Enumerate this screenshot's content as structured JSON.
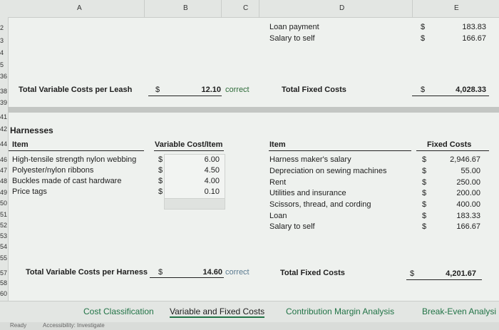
{
  "column_headers": [
    "A",
    "B",
    "C",
    "D",
    "E"
  ],
  "row_numbers": {
    "r2": "2",
    "r3": "3",
    "r4": "4",
    "r5": "5",
    "r6": "36",
    "r38": "38",
    "r39": "39",
    "r41": "41",
    "r42": "42",
    "r44": "44",
    "r46": "46",
    "r47": "47",
    "r48": "48",
    "r49": "49",
    "r50": "50",
    "r51": "51",
    "r52": "52",
    "r53": "53",
    "r54": "54",
    "r55": "55",
    "r57": "57",
    "r58": "58",
    "r60": "60"
  },
  "leash": {
    "fixed_items": [
      {
        "label": "Loan payment",
        "currency": "$",
        "value": "183.83"
      },
      {
        "label": "Salary to self",
        "currency": "$",
        "value": "166.67"
      }
    ],
    "total_variable_label": "Total Variable Costs per Leash",
    "total_variable_currency": "$",
    "total_variable_value": "12.10",
    "total_variable_check": "correct",
    "total_fixed_label": "Total Fixed Costs",
    "total_fixed_currency": "$",
    "total_fixed_value": "4,028.33"
  },
  "harnesses": {
    "title": "Harnesses",
    "item_header": "Item",
    "varcost_header": "Variable Cost/Item",
    "fixed_item_header": "Item",
    "fixed_cost_header": "Fixed Costs",
    "variable_items": [
      {
        "label": "High-tensile strength nylon webbing",
        "currency": "$",
        "value": "6.00"
      },
      {
        "label": "Polyester/nylon ribbons",
        "currency": "$",
        "value": "4.50"
      },
      {
        "label": "Buckles made of cast hardware",
        "currency": "$",
        "value": "4.00"
      },
      {
        "label": "Price tags",
        "currency": "$",
        "value": "0.10"
      }
    ],
    "fixed_items": [
      {
        "label": "Harness maker's salary",
        "currency": "$",
        "value": "2,946.67"
      },
      {
        "label": "Depreciation on sewing machines",
        "currency": "$",
        "value": "55.00"
      },
      {
        "label": "Rent",
        "currency": "$",
        "value": "250.00"
      },
      {
        "label": "Utilities and insurance",
        "currency": "$",
        "value": "200.00"
      },
      {
        "label": "Scissors, thread, and cording",
        "currency": "$",
        "value": "400.00"
      },
      {
        "label": "Loan",
        "currency": "$",
        "value": "183.33"
      },
      {
        "label": "Salary to self",
        "currency": "$",
        "value": "166.67"
      }
    ],
    "total_variable_label": "Total Variable Costs per Harness",
    "total_variable_currency": "$",
    "total_variable_value": "14.60",
    "total_variable_check": "correct",
    "total_fixed_label": "Total Fixed Costs",
    "total_fixed_currency": "$",
    "total_fixed_value": "4,201.67"
  },
  "tabs": [
    {
      "label": "Cost Classification"
    },
    {
      "label": "Variable and Fixed Costs",
      "active": true
    },
    {
      "label": "Contribution Margin Analysis"
    },
    {
      "label": "Break-Even Analysi"
    }
  ],
  "status": {
    "ready": "Ready",
    "accessibility": "Accessibility: Investigate"
  }
}
